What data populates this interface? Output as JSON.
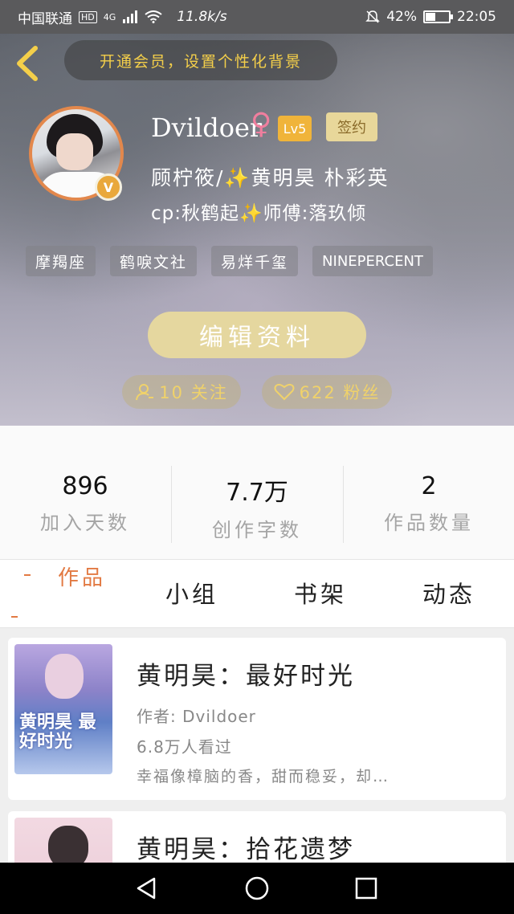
{
  "status_bar": {
    "carrier": "中国联通",
    "hd": "HD",
    "network": "4G",
    "speed": "11.8k/s",
    "battery": "42%",
    "battery_level": 0.42,
    "time": "22:05"
  },
  "profile": {
    "vip_banner": "开通会员，设置个性化背景",
    "avatar_badge": "V",
    "username": "Dvildoer",
    "gender_symbol": "♀",
    "level": "Lv5",
    "signed": "签约",
    "bio_line1": "顾柠筱/✨黄明昊 朴彩英",
    "bio_line2": "cp:秋鹤起✨师傅:落玖倾",
    "tags": [
      "摩羯座",
      "鹤唳文社",
      "易烊千玺",
      "NINEPERCENT"
    ],
    "edit_button": "编辑资料",
    "following": "10 关注",
    "fans": "622 粉丝"
  },
  "stats": [
    {
      "value": "896",
      "label": "加入天数"
    },
    {
      "value": "7.7万",
      "label": "创作字数"
    },
    {
      "value": "2",
      "label": "作品数量"
    }
  ],
  "tabs": [
    "作品",
    "小组",
    "书架",
    "动态"
  ],
  "works": [
    {
      "title": "黄明昊：最好时光",
      "author": "作者: Dvildoer",
      "views": "6.8万人看过",
      "desc": "幸福像樟脑的香，甜而稳妥，却…",
      "cover_text": "黄明昊 最好时光"
    },
    {
      "title": "黄明昊：拾花遗梦"
    }
  ],
  "colors": {
    "accent_orange": "#e27a43",
    "gold": "#f0b43a",
    "vip_yellow": "#f4cf4a"
  }
}
